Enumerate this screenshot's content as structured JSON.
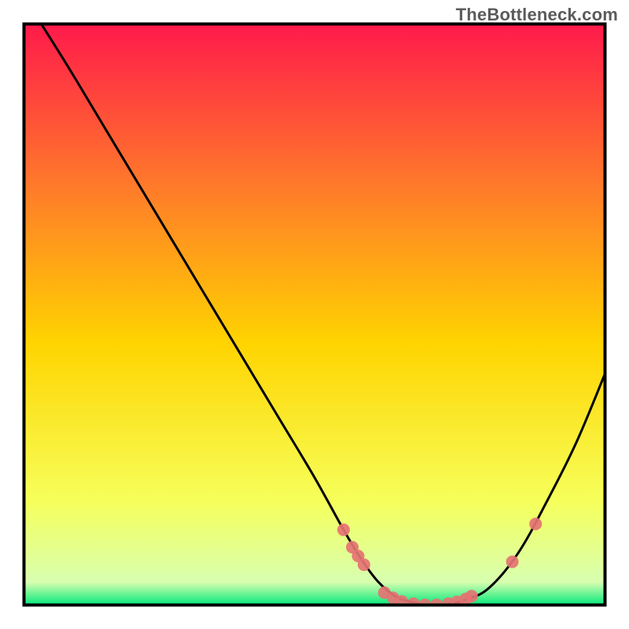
{
  "watermark": "TheBottleneck.com",
  "colors": {
    "curve": "#000000",
    "dot": "#e57373",
    "border": "#000000",
    "gradient_top": "#ff1a4b",
    "gradient_mid1": "#ff7a2a",
    "gradient_mid2": "#ffd400",
    "gradient_mid3": "#f6ff5a",
    "gradient_bottom": "#00e87a"
  },
  "chart_data": {
    "type": "line",
    "title": "",
    "xlabel": "",
    "ylabel": "",
    "xlim": [
      0,
      100
    ],
    "ylim": [
      0,
      100
    ],
    "x": [
      3,
      8,
      14,
      20,
      26,
      32,
      38,
      44,
      50,
      55,
      58,
      61,
      64,
      67,
      70,
      73,
      76,
      80,
      85,
      90,
      95,
      100
    ],
    "y": [
      100,
      92,
      82,
      72,
      62,
      52,
      42,
      32,
      22,
      13,
      8,
      4,
      1.5,
      0.5,
      0,
      0.2,
      1,
      3,
      9,
      18,
      28,
      40
    ],
    "legend": [],
    "notes": "Valley-shaped bottleneck curve. Left wall descends steeply from top-left; flat bottom near x≈62–75; rises again to the right.",
    "dots_overlay": [
      {
        "x": 55,
        "y": 13
      },
      {
        "x": 56.5,
        "y": 10
      },
      {
        "x": 57.5,
        "y": 8.5
      },
      {
        "x": 58.5,
        "y": 7
      },
      {
        "x": 62,
        "y": 2.2
      },
      {
        "x": 63.5,
        "y": 1.3
      },
      {
        "x": 65,
        "y": 0.7
      },
      {
        "x": 67,
        "y": 0.3
      },
      {
        "x": 69,
        "y": 0.1
      },
      {
        "x": 71,
        "y": 0.1
      },
      {
        "x": 73,
        "y": 0.3
      },
      {
        "x": 74.5,
        "y": 0.6
      },
      {
        "x": 76,
        "y": 1.1
      },
      {
        "x": 77,
        "y": 1.6
      },
      {
        "x": 84,
        "y": 7.5
      },
      {
        "x": 88,
        "y": 14
      }
    ]
  }
}
